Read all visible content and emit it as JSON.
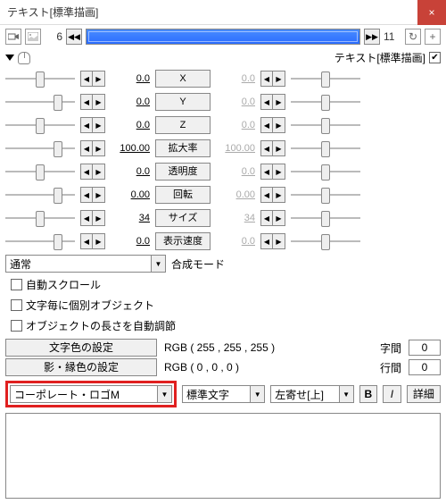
{
  "title": "テキスト[標準描画]",
  "frame_start": "6",
  "frame_end": "11",
  "object_label": "テキスト[標準描画]",
  "params": [
    {
      "name": "x",
      "label": "X",
      "left": "0.0",
      "right": "0.0",
      "gray": true
    },
    {
      "name": "y",
      "label": "Y",
      "left": "0.0",
      "right": "0.0",
      "gray": true
    },
    {
      "name": "z",
      "label": "Z",
      "left": "0.0",
      "right": "0.0",
      "gray": true
    },
    {
      "name": "zoom",
      "label": "拡大率",
      "left": "100.00",
      "right": "100.00",
      "gray": true
    },
    {
      "name": "alpha",
      "label": "透明度",
      "left": "0.0",
      "right": "0.0",
      "gray": true
    },
    {
      "name": "rot",
      "label": "回転",
      "left": "0.00",
      "right": "0.00",
      "gray": true
    },
    {
      "name": "size",
      "label": "サイズ",
      "left": "34",
      "right": "34",
      "gray": true
    },
    {
      "name": "speed",
      "label": "表示速度",
      "left": "0.0",
      "right": "0.0",
      "gray": true
    }
  ],
  "blend_mode": {
    "label": "合成モード",
    "value": "通常"
  },
  "checks": {
    "autoscroll": "自動スクロール",
    "perchar": "文字毎に個別オブジェクト",
    "autolen": "オブジェクトの長さを自動調節"
  },
  "color": {
    "textbtn": "文字色の設定",
    "textval": "RGB ( 255 , 255 , 255 )",
    "edgebtn": "影・縁色の設定",
    "edgeval": "RGB ( 0 , 0 , 0 )",
    "spacing_label": "字間",
    "spacing_val": "0",
    "leading_label": "行間",
    "leading_val": "0"
  },
  "font": {
    "name": "コーポレート・ロゴM",
    "style": "標準文字",
    "align": "左寄せ[上]",
    "b": "B",
    "i": "I",
    "detail": "詳細"
  }
}
